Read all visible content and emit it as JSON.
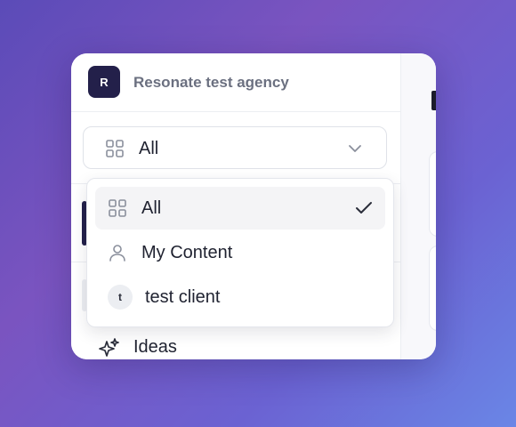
{
  "organization": {
    "avatar_letter": "R",
    "name": "Resonate test agency"
  },
  "filter": {
    "selected_label": "All",
    "icon": "grid-icon",
    "chevron": "chevron-down-icon"
  },
  "dropdown": {
    "options": [
      {
        "label": "All",
        "icon": "grid-icon",
        "selected": true
      },
      {
        "label": "My Content",
        "icon": "user-icon",
        "selected": false
      },
      {
        "label": "test client",
        "avatar_letter": "t",
        "selected": false
      }
    ]
  },
  "sidebar": {
    "items": [
      {
        "label": "Ideas",
        "icon": "sparkles-icon"
      }
    ]
  },
  "colors": {
    "brand_dark": "#23204a",
    "background_gradient_start": "#5b4bb8",
    "background_gradient_end": "#6a86e6"
  }
}
